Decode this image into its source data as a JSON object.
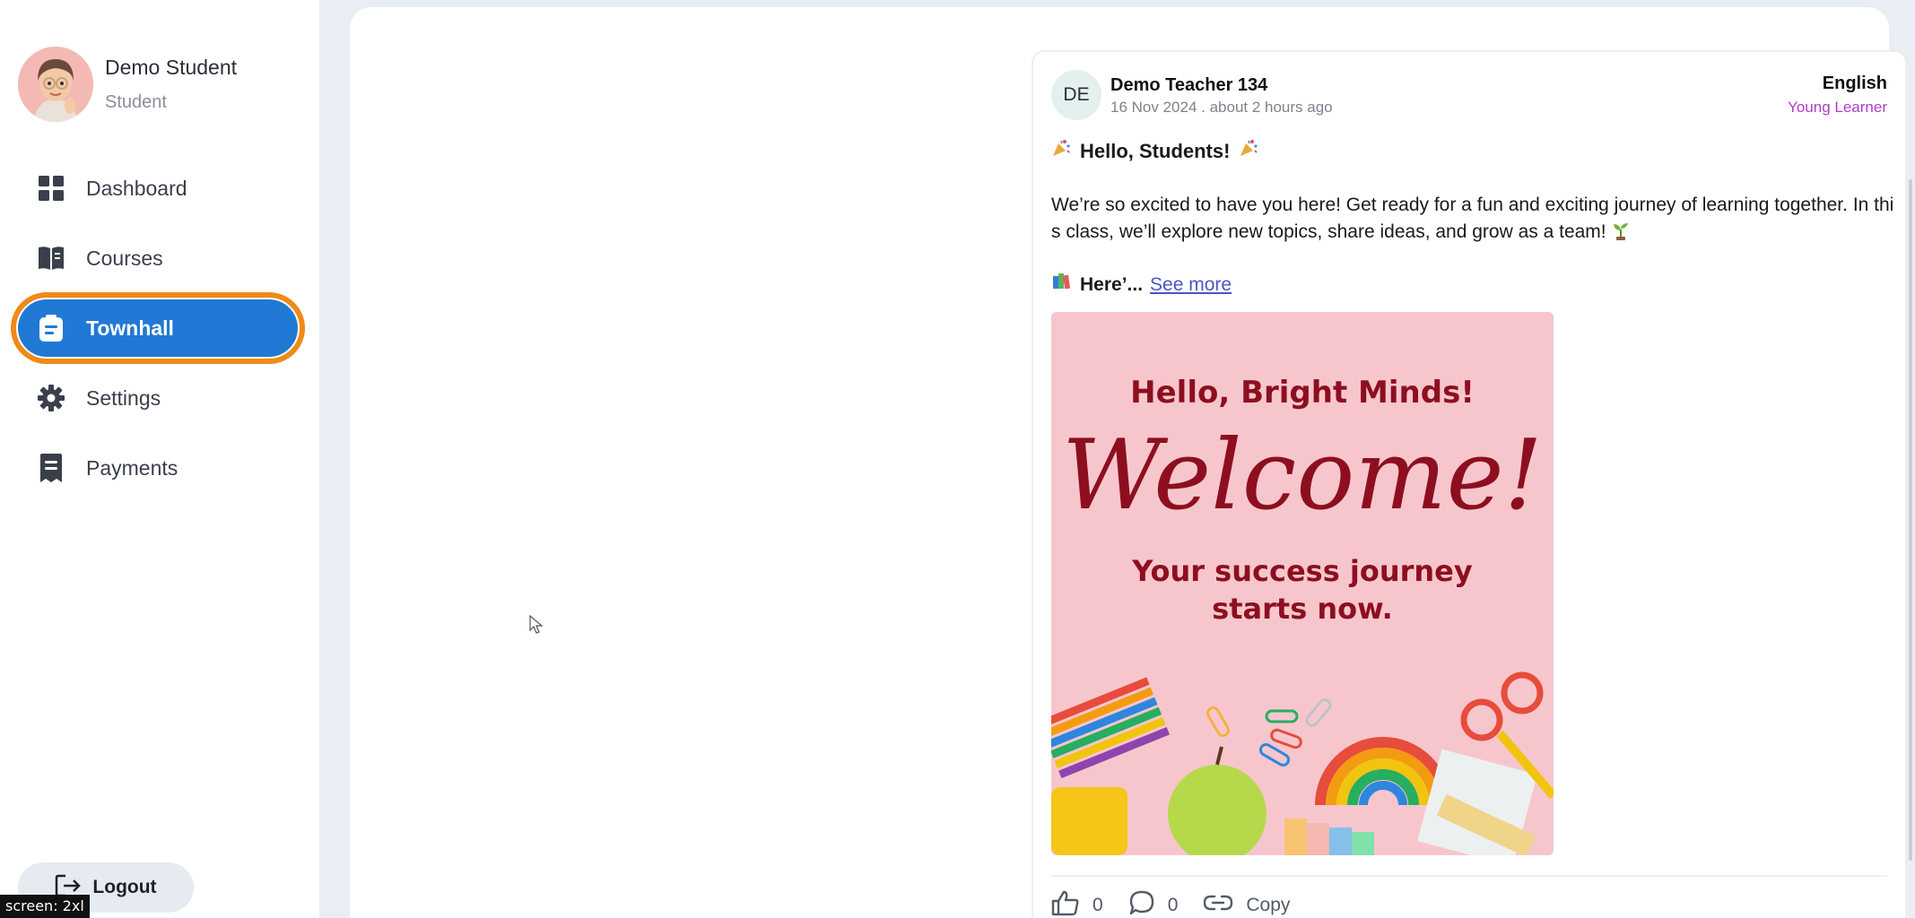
{
  "user": {
    "name": "Demo Student",
    "role": "Student"
  },
  "nav": [
    {
      "label": "Dashboard",
      "icon": "grid-icon"
    },
    {
      "label": "Courses",
      "icon": "book-icon"
    },
    {
      "label": "Townhall",
      "icon": "clipboard-icon",
      "active": true
    },
    {
      "label": "Settings",
      "icon": "gear-icon"
    },
    {
      "label": "Payments",
      "icon": "receipt-icon"
    }
  ],
  "logout_label": "Logout",
  "screen_tag": "screen: 2xl",
  "post": {
    "avatar_initials": "DE",
    "author": "Demo Teacher 134",
    "meta": "16 Nov 2024 . about 2 hours ago",
    "language": "English",
    "level": "Young Learner",
    "greeting": "Hello, Students!",
    "intro": "We’re so excited to have you here! Get ready for a fun and exciting journey of learning together. In this class, we’ll explore new topics, share ideas, and grow as a team!",
    "teaser": "Here’...",
    "see_more": "See more",
    "image": {
      "line1": "Hello, Bright Minds!",
      "line2": "Welcome!",
      "line3a": "Your success journey",
      "line3b": "starts now."
    },
    "likes": "0",
    "comments": "0",
    "copy_label": "Copy"
  },
  "colors": {
    "accent": "#2079d4",
    "highlight": "#ef8a17",
    "level": "#b03cc6",
    "image_text": "#8d0f1f"
  }
}
